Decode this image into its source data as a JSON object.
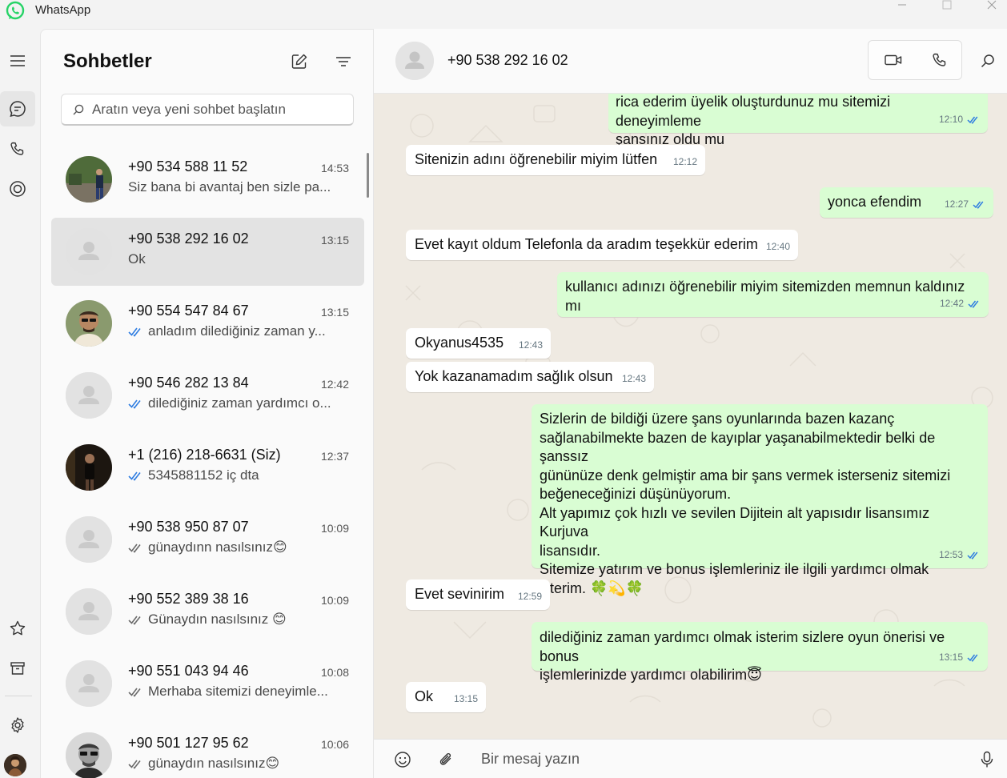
{
  "app": {
    "title": "WhatsApp",
    "accent": "#25d366",
    "tick_color": "#2f7de1"
  },
  "panel": {
    "title": "Sohbetler",
    "search_placeholder": "Aratın veya yeni sohbet başlatın"
  },
  "chats": [
    {
      "name": "+90 534 588 11 52",
      "time": "14:53",
      "preview": "Siz bana bi avantaj ben sizle pa...",
      "ticks": "none",
      "avatar": "photo-park",
      "selected": false
    },
    {
      "name": "+90 538 292 16 02",
      "time": "13:15",
      "preview": "Ok",
      "ticks": "none",
      "avatar": "default",
      "selected": true
    },
    {
      "name": "+90 554 547 84 67",
      "time": "13:15",
      "preview": "anladım dilediğiniz zaman y...",
      "ticks": "read",
      "avatar": "photo-man-sunglasses",
      "selected": false
    },
    {
      "name": "+90 546 282 13 84",
      "time": "12:42",
      "preview": "dilediğiniz zaman yardımcı o...",
      "ticks": "read",
      "avatar": "default",
      "selected": false
    },
    {
      "name": "+1 (216) 218-6631 (Siz)",
      "time": "12:37",
      "preview": "5345881152 iç dta",
      "ticks": "read",
      "avatar": "photo-dark",
      "selected": false
    },
    {
      "name": "+90 538 950 87 07",
      "time": "10:09",
      "preview": "günaydınn nasılsınız😊",
      "ticks": "delivered",
      "avatar": "default",
      "selected": false
    },
    {
      "name": "+90 552 389 38 16",
      "time": "10:09",
      "preview": "Günaydın nasılsınız 😊",
      "ticks": "delivered",
      "avatar": "default",
      "selected": false
    },
    {
      "name": "+90 551 043 94 46",
      "time": "10:08",
      "preview": "Merhaba sitemizi deneyimle...",
      "ticks": "delivered",
      "avatar": "default",
      "selected": false
    },
    {
      "name": "+90 501 127 95 62",
      "time": "10:06",
      "preview": "günaydın nasılsınız😊",
      "ticks": "delivered",
      "avatar": "photo-man-glasses",
      "selected": false
    }
  ],
  "conversation": {
    "contact": "+90 538 292 16 02",
    "composer_placeholder": "Bir mesaj yazın",
    "messages": [
      {
        "dir": "out",
        "text": "rica ederim üyelik oluşturdunuz mu sitemizi deneyimleme\nşansınız oldu mu",
        "time": "12:10"
      },
      {
        "dir": "in",
        "text": "Sitenizin adını öğrenebilir miyim lütfen",
        "time": "12:12"
      },
      {
        "dir": "out",
        "text": "yonca efendim",
        "time": "12:27"
      },
      {
        "dir": "in",
        "text": "Evet kayıt oldum Telefonla da aradım teşekkür ederim",
        "time": "12:40"
      },
      {
        "dir": "out",
        "text": "kullanıcı adınızı öğrenebilir miyim sitemizden memnun kaldınız mı",
        "time": "12:42"
      },
      {
        "dir": "in",
        "text": "Okyanus4535",
        "time": "12:43"
      },
      {
        "dir": "in",
        "text": "Yok kazanamadım sağlık olsun",
        "time": "12:43"
      },
      {
        "dir": "out",
        "text": "Sizlerin de bildiği üzere şans oyunlarında bazen kazanç\nsağlanabilmekte  bazen de kayıplar yaşanabilmektedir belki de şanssız\ngününüze denk gelmiştir ama bir şans vermek isterseniz sitemizi\nbeğeneceğinizi düşünüyorum.\nAlt yapımız çok hızlı ve sevilen Dijitein alt yapısıdır lisansımız Kurjuva\nlisansıdır.\nSitemize yatırım ve bonus işlemleriniz  ile ilgili  yardımcı olmak\nisterim. 🍀💫🍀",
        "time": "12:53"
      },
      {
        "dir": "in",
        "text": "Evet sevinirim",
        "time": "12:59"
      },
      {
        "dir": "out",
        "text": "dilediğiniz zaman yardımcı olmak isterim sizlere oyun önerisi ve bonus\nişlemlerinizde yardımcı olabilirim😇",
        "time": "13:15"
      },
      {
        "dir": "in",
        "text": "Ok",
        "time": "13:15"
      }
    ]
  }
}
